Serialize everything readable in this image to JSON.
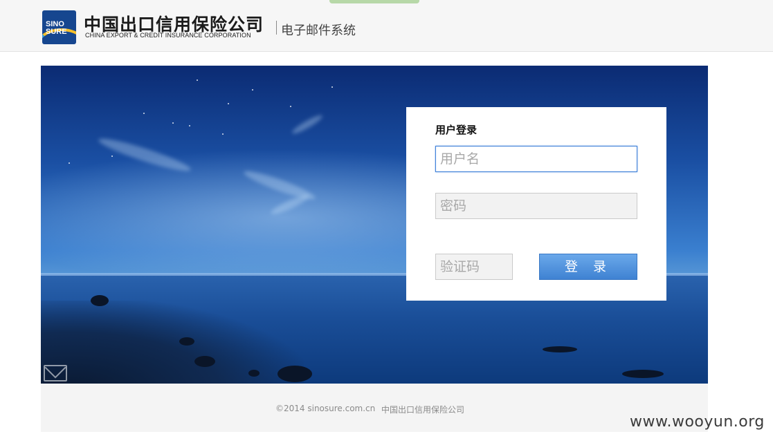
{
  "header": {
    "logo_badge_line1": "SINO",
    "logo_badge_line2": "SURE",
    "company_name_cn": "中国出口信用保险公司",
    "company_name_en": "CHINA EXPORT & CREDIT INSURANCE CORPORATION",
    "system_name": "电子邮件系统"
  },
  "login": {
    "title": "用户登录",
    "username_placeholder": "用户名",
    "password_placeholder": "密码",
    "captcha_placeholder": "验证码",
    "submit_label": "登 录"
  },
  "footer": {
    "copyright": "©2014 sinosure.com.cn",
    "company": "中国出口信用保险公司"
  },
  "watermark": "www.wooyun.org",
  "colors": {
    "login_button": "#4a8ddc",
    "topbar_bg": "#f6f6f6",
    "hero_sky": "#1a4fa3"
  },
  "icons": [
    "mail-icon",
    "sinosure-logo"
  ]
}
